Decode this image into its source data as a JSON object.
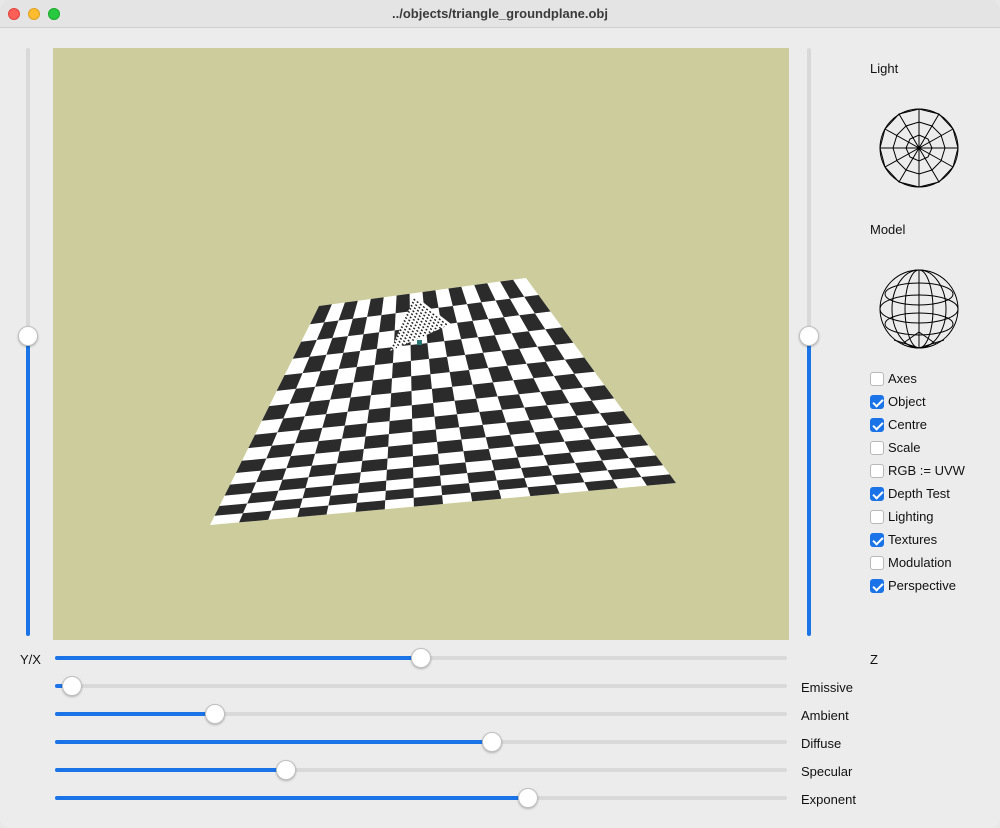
{
  "window": {
    "title": "../objects/triangle_groundplane.obj"
  },
  "colors": {
    "accent": "#1a74e8",
    "track": "#d9d9d9",
    "viewport_bg": "#cccc9c",
    "checker_dark": "#2b2b2b",
    "checker_light": "#ffffff"
  },
  "sliders": {
    "left_vertical": {
      "value": 0.51
    },
    "right_vertical": {
      "value": 0.51
    },
    "yx": {
      "label": "Y/X",
      "value": 0.5
    },
    "z": {
      "label": "Z"
    },
    "emissive": {
      "label": "Emissive",
      "value": 0.01
    },
    "ambient": {
      "label": "Ambient",
      "value": 0.21
    },
    "diffuse": {
      "label": "Diffuse",
      "value": 0.6
    },
    "specular": {
      "label": "Specular",
      "value": 0.31
    },
    "exponent": {
      "label": "Exponent",
      "value": 0.65
    }
  },
  "side": {
    "light_label": "Light",
    "model_label": "Model"
  },
  "checkboxes": [
    {
      "label": "Axes",
      "checked": false
    },
    {
      "label": "Object",
      "checked": true
    },
    {
      "label": "Centre",
      "checked": true
    },
    {
      "label": "Scale",
      "checked": false
    },
    {
      "label": "RGB := UVW",
      "checked": false
    },
    {
      "label": "Depth Test",
      "checked": true
    },
    {
      "label": "Lighting",
      "checked": false
    },
    {
      "label": "Textures",
      "checked": true
    },
    {
      "label": "Modulation",
      "checked": false
    },
    {
      "label": "Perspective",
      "checked": true
    }
  ]
}
